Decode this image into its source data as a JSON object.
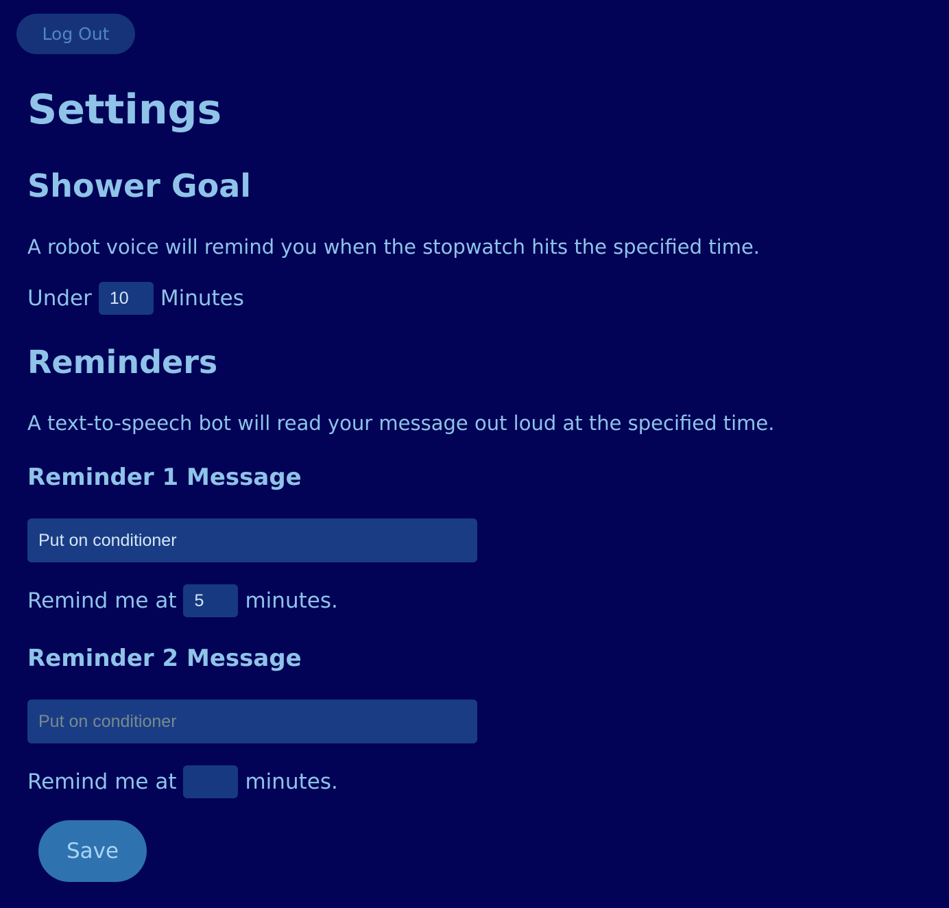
{
  "header": {
    "logout_label": "Log Out"
  },
  "page": {
    "title": "Settings"
  },
  "shower_goal": {
    "title": "Shower Goal",
    "description": "A robot voice will remind you when the stopwatch hits the specified time.",
    "prefix": "Under",
    "value": "10",
    "suffix": "Minutes"
  },
  "reminders": {
    "title": "Reminders",
    "description": "A text-to-speech bot will read your message out loud at the specified time.",
    "items": [
      {
        "label": "Reminder 1 Message",
        "message_value": "Put on conditioner",
        "message_placeholder": "",
        "remind_prefix": "Remind me at",
        "minutes_value": "5",
        "remind_suffix": "minutes."
      },
      {
        "label": "Reminder 2 Message",
        "message_value": "",
        "message_placeholder": "Put on conditioner",
        "remind_prefix": "Remind me at",
        "minutes_value": "",
        "remind_suffix": "minutes."
      }
    ]
  },
  "footer": {
    "save_label": "Save"
  },
  "colors": {
    "background": "#020356",
    "text": "#8fc3e8",
    "input_bg": "#193c85",
    "save_bg": "#2f72b0",
    "logout_bg": "#16337a"
  }
}
